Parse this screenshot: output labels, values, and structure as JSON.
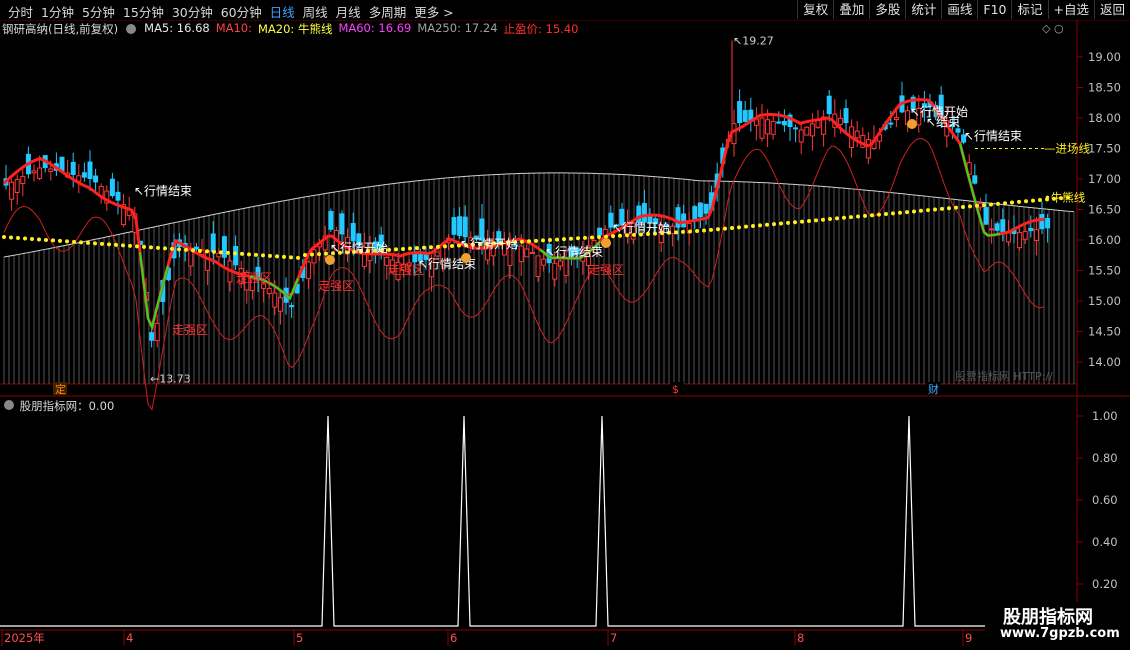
{
  "toolbar": {
    "tabs": [
      {
        "label": "分时"
      },
      {
        "label": "1分钟"
      },
      {
        "label": "5分钟"
      },
      {
        "label": "15分钟"
      },
      {
        "label": "30分钟"
      },
      {
        "label": "60分钟"
      },
      {
        "label": "日线",
        "active": true
      },
      {
        "label": "周线"
      },
      {
        "label": "月线"
      },
      {
        "label": "多周期"
      },
      {
        "label": "更多"
      }
    ],
    "more_arrow": ">",
    "buttons": [
      "复权",
      "叠加",
      "多股",
      "统计",
      "画线",
      "F10",
      "标记",
      "+自选",
      "返回"
    ]
  },
  "main_chart": {
    "title": "钢研高纳(日线,前复权)",
    "ma_labels": [
      {
        "text": "MA5: 16.68",
        "color": "#e8e8e8"
      },
      {
        "text": "MA10:",
        "color": "#ff4040"
      },
      {
        "text": "MA20: 牛熊线",
        "color": "#ffff40"
      },
      {
        "text": "MA60: 16.69",
        "color": "#ff40ff"
      },
      {
        "text": "MA250: 17.24",
        "color": "#a0a0a0"
      },
      {
        "text": "止盈价: 15.40",
        "color": "#ff3030"
      }
    ],
    "y_axis": [
      "19.00",
      "18.50",
      "18.00",
      "17.50",
      "17.00",
      "16.50",
      "16.00",
      "15.50",
      "15.00",
      "14.50",
      "14.00"
    ],
    "high_label": "19.27",
    "low_label": "13.73",
    "annotations": [
      {
        "text": "行情结束",
        "color": "#ffffff"
      },
      {
        "text": "行情开始",
        "color": "#ffffff"
      },
      {
        "text": "行情结束",
        "color": "#ffffff"
      },
      {
        "text": "行情开始",
        "color": "#ffffff"
      },
      {
        "text": "行情结束",
        "color": "#ffffff"
      },
      {
        "text": "行情开始",
        "color": "#ffffff"
      },
      {
        "text": "行情开始",
        "color": "#ffffff"
      },
      {
        "text": "结束",
        "color": "#ffffff"
      },
      {
        "text": "行情结束",
        "color": "#ffffff"
      }
    ],
    "red_labels": [
      "走强区",
      "走强区",
      "走强区",
      "走强区",
      "走强区"
    ],
    "right_labels": {
      "entry": "进场线",
      "bull": "牛熊线"
    },
    "markers": [
      "定",
      "$",
      "财"
    ],
    "faint_watermark": "股票指标网 HTTP://"
  },
  "sub_chart": {
    "title": "股朋指标网：0.00",
    "y_axis": [
      "1.00",
      "0.80",
      "0.60",
      "0.40",
      "0.20"
    ]
  },
  "x_axis": [
    "2025年",
    "4",
    "5",
    "6",
    "7",
    "8",
    "9"
  ],
  "watermark": {
    "line1": "股朋指标网",
    "line2": "www.7gpzb.com"
  }
}
